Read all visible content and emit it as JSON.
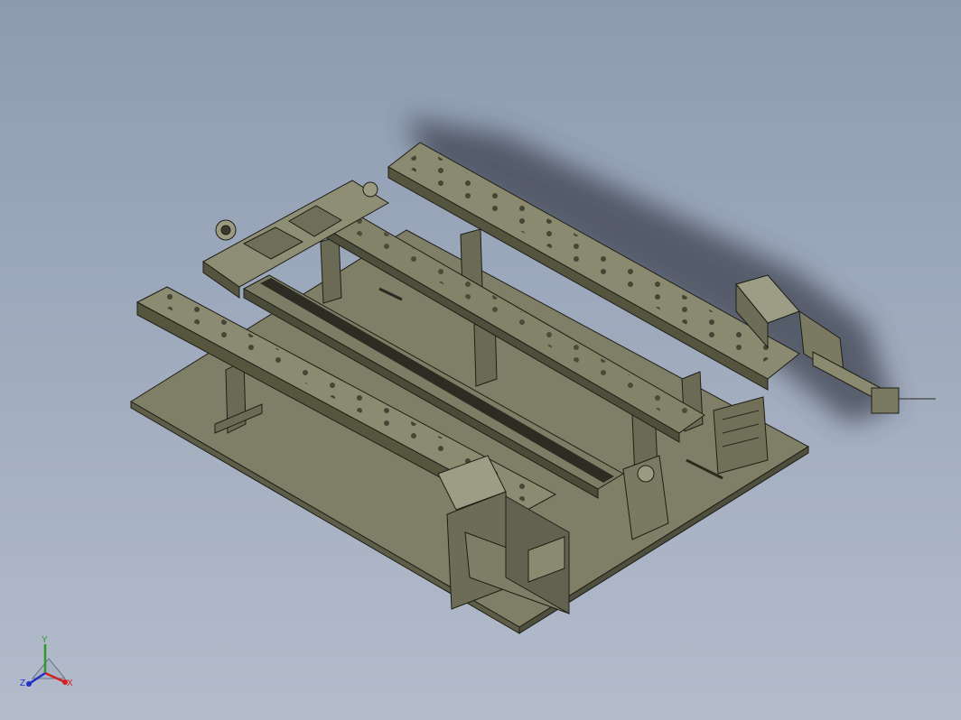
{
  "viewport": {
    "background_top": "#8d9bb1",
    "background_bottom": "#b3bccb"
  },
  "model": {
    "body_color": "#7a7a62",
    "edge_color": "#1e1e16",
    "shadow_color": "#3c4250"
  },
  "triad": {
    "x_label": "X",
    "y_label": "Y",
    "z_label": "Z",
    "x_color": "#d42020",
    "y_color": "#2e9a2e",
    "z_color": "#2030c8"
  }
}
